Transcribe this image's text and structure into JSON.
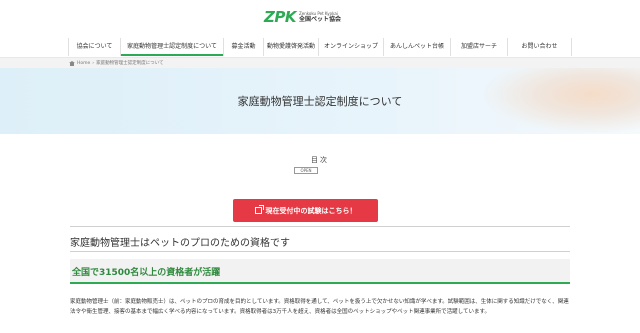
{
  "header": {
    "logo_mark": "ZPK",
    "logo_sub1": "Zenkoku Pet Kyokai",
    "logo_sub2": "全国ペット協会"
  },
  "nav": {
    "items": [
      {
        "label": "協会について"
      },
      {
        "label": "家庭動物管理士認定制度について"
      },
      {
        "label": "募金活動"
      },
      {
        "label": "動物愛護啓発活動"
      },
      {
        "label": "オンラインショップ"
      },
      {
        "label": "あんしんペット台帳"
      },
      {
        "label": "加盟店サーチ"
      },
      {
        "label": "お問い合わせ"
      }
    ]
  },
  "breadcrumb": {
    "home": "Home",
    "current": "家庭動物管理士認定制度について"
  },
  "hero": {
    "title": "家庭動物管理士認定制度について"
  },
  "toc": {
    "title": "目次",
    "toggle": "OPEN"
  },
  "cta": {
    "label": "現在受付中の試験はこちら！"
  },
  "section": {
    "heading": "家庭動物管理士はペットのプロのための資格です",
    "subheading": "全国で31500名以上の資格者が活躍",
    "paragraph": "家庭動物管理士（前：家庭動物販売士）は、ペットのプロの育成を目的としています。資格取得を通して、ペットを扱う上で欠かせない知識が学べます。試験範囲は、生体に関する知識だけでなく、関連法令や衛生管理、接客の基本まで幅広く学べる内容になっています。資格取得者は3万千人を超え、資格者は全国のペットショップやペット関連事業所で活躍しています。"
  },
  "colors": {
    "brand_green": "#2eaa55",
    "cta_red": "#e53a45"
  }
}
